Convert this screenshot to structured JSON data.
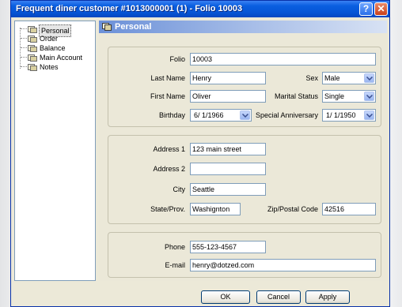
{
  "window": {
    "title": "Frequent diner customer #1013000001 (1) - Folio 10003",
    "help_label": "?",
    "close_label": "✕"
  },
  "tree": {
    "items": [
      {
        "label": "Personal",
        "icon": "page-icon",
        "selected": true
      },
      {
        "label": "Order",
        "icon": "page-icon"
      },
      {
        "label": "Balance",
        "icon": "page-icon"
      },
      {
        "label": "Main Account",
        "icon": "page-icon"
      },
      {
        "label": "Notes",
        "icon": "page-icon"
      }
    ]
  },
  "panel": {
    "title": "Personal",
    "icon": "page-icon"
  },
  "personal": {
    "folio_label": "Folio",
    "folio": "10003",
    "last_name_label": "Last Name",
    "last_name": "Henry",
    "sex_label": "Sex",
    "sex": "Male",
    "first_name_label": "First Name",
    "first_name": "Oliver",
    "marital_label": "Marital Status",
    "marital": "Single",
    "birthday_label": "Birthday",
    "birthday": "6/ 1/1966",
    "anniversary_label": "Special Anniversary",
    "anniversary": "1/ 1/1950"
  },
  "address": {
    "address1_label": "Address 1",
    "address1": "123 main street",
    "address2_label": "Address 2",
    "address2": "",
    "city_label": "City",
    "city": "Seattle",
    "state_label": "State/Prov.",
    "state": "Washignton",
    "zip_label": "Zip/Postal Code",
    "zip": "42516"
  },
  "contact": {
    "phone_label": "Phone",
    "phone": "555-123-4567",
    "email_label": "E-mail",
    "email": "henry@dotzed.com"
  },
  "buttons": {
    "ok": "OK",
    "cancel": "Cancel",
    "apply": "Apply"
  },
  "colors": {
    "titlebar": "#0655d6",
    "panel_header": "#6b90d8",
    "dialog_bg": "#ece9d8"
  }
}
